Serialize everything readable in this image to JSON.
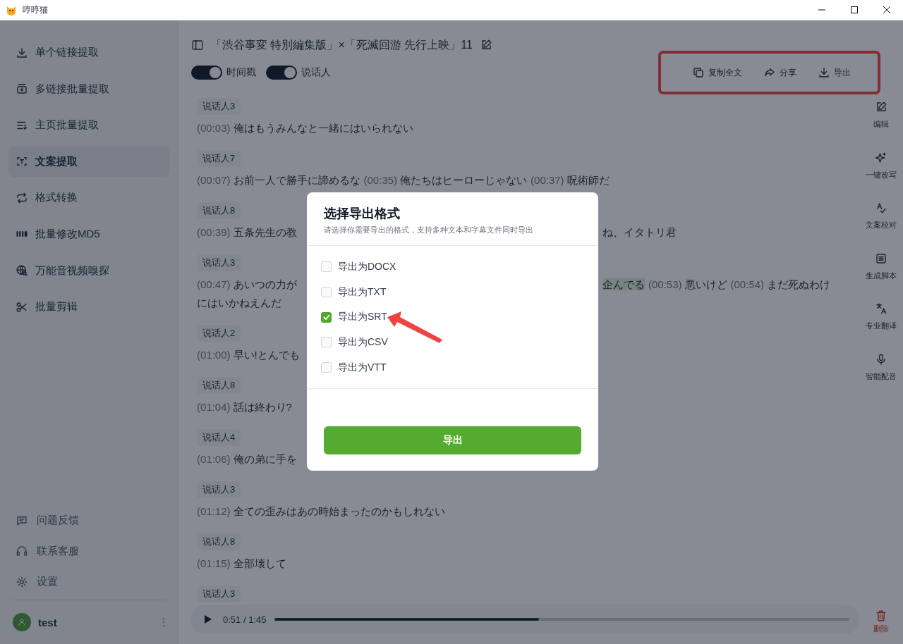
{
  "window": {
    "title": "哼哼猫"
  },
  "sidebar": {
    "items": [
      {
        "label": "单个链接提取",
        "selected": false
      },
      {
        "label": "多链接批量提取",
        "selected": false
      },
      {
        "label": "主页批量提取",
        "selected": false
      },
      {
        "label": "文案提取",
        "selected": true
      },
      {
        "label": "格式转换",
        "selected": false
      },
      {
        "label": "批量修改MD5",
        "selected": false
      },
      {
        "label": "万能音视频嗅探",
        "selected": false
      },
      {
        "label": "批量剪辑",
        "selected": false
      }
    ],
    "footer_items": [
      {
        "label": "问题反馈"
      },
      {
        "label": "联系客服"
      },
      {
        "label": "设置"
      }
    ],
    "user": {
      "name": "test"
    }
  },
  "document": {
    "title": "「渋谷事変 特別編集版」×「死滅回游 先行上映」11",
    "toggles": [
      {
        "label": "时间戳",
        "on": true
      },
      {
        "label": "说话人",
        "on": true
      }
    ],
    "actions": [
      {
        "label": "复制全文"
      },
      {
        "label": "分享"
      },
      {
        "label": "导出"
      }
    ],
    "entries": [
      {
        "speaker": "说话人3",
        "segments": [
          {
            "time": "(00:03)",
            "text": "俺はもうみんなと一緒にはいられない",
            "highlighted": false
          }
        ]
      },
      {
        "speaker": "说话人7",
        "segments": [
          {
            "time": "(00:07)",
            "text": "お前一人で勝手に諦めるな",
            "highlighted": false
          },
          {
            "time": "(00:35)",
            "text": "俺たちはヒーローじゃない",
            "highlighted": false
          },
          {
            "time": "(00:37)",
            "text": "呪術師だ",
            "highlighted": false
          }
        ]
      },
      {
        "speaker": "说话人8",
        "segments": [
          {
            "time": "(00:39)",
            "text": "五条先生の教",
            "highlighted": false
          }
        ],
        "right_segments": [
          {
            "text": "ね、イタトリ君",
            "highlighted": false
          }
        ]
      },
      {
        "speaker": "说话人3",
        "segments": [
          {
            "time": "(00:47)",
            "text": "あいつの力が",
            "highlighted": false
          }
        ],
        "right_segments": [
          {
            "text": "企んでる",
            "highlighted": true
          },
          {
            "time": "(00:53)",
            "text": "悪いけど",
            "highlighted": false
          },
          {
            "time": "(00:54)",
            "text": "まだ死ぬわけ",
            "highlighted": false
          }
        ],
        "continuation": "にはいかねえんだ"
      },
      {
        "speaker": "说话人2",
        "segments": [
          {
            "time": "(01:00)",
            "text": "早い!とんでも",
            "highlighted": false
          }
        ]
      },
      {
        "speaker": "说话人8",
        "segments": [
          {
            "time": "(01:04)",
            "text": "話は終わり?",
            "highlighted": false
          }
        ]
      },
      {
        "speaker": "说话人4",
        "segments": [
          {
            "time": "(01:06)",
            "text": "俺の弟に手を",
            "highlighted": false
          }
        ]
      },
      {
        "speaker": "说话人3",
        "segments": [
          {
            "time": "(01:12)",
            "text": "全ての歪みはあの時始まったのかもしれない",
            "highlighted": false
          }
        ]
      },
      {
        "speaker": "说话人8",
        "segments": [
          {
            "time": "(01:15)",
            "text": "全部壊して",
            "highlighted": false
          }
        ]
      },
      {
        "speaker": "说话人3"
      }
    ]
  },
  "tools": [
    {
      "label": "编辑"
    },
    {
      "label": "一键改写"
    },
    {
      "label": "文案校对"
    },
    {
      "label": "生成脚本"
    },
    {
      "label": "专业翻译"
    },
    {
      "label": "智能配音"
    }
  ],
  "player": {
    "time": "0:51 / 1:45",
    "level": 0.46
  },
  "delete_button": {
    "label": "删除"
  },
  "dialog": {
    "title": "选择导出格式",
    "subtitle": "请选择你需要导出的格式，支持多种文本和字幕文件同时导出",
    "options": [
      {
        "label": "导出为DOCX",
        "checked": false
      },
      {
        "label": "导出为TXT",
        "checked": false
      },
      {
        "label": "导出为SRT",
        "checked": true
      },
      {
        "label": "导出为CSV",
        "checked": false
      },
      {
        "label": "导出为VTT",
        "checked": false
      }
    ],
    "button": "导出"
  }
}
